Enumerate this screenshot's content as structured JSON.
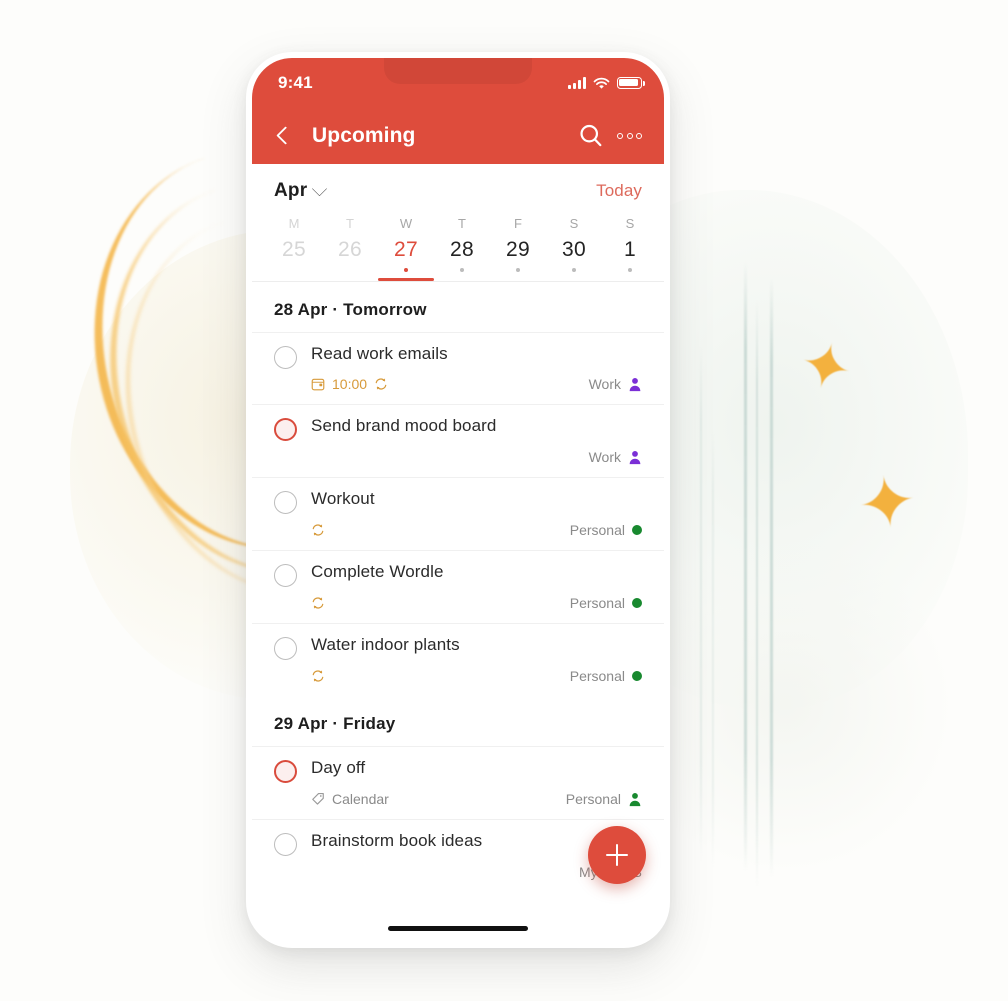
{
  "status_bar": {
    "time": "9:41",
    "icons": [
      "signal-bars-icon",
      "wifi-icon",
      "battery-icon"
    ]
  },
  "app_bar": {
    "back_icon": "chevron-left-icon",
    "title": "Upcoming",
    "search_icon": "search-icon",
    "overflow_icon": "more-options-icon"
  },
  "calendar": {
    "month_label": "Apr",
    "month_chevron_icon": "chevron-down-icon",
    "today_label": "Today",
    "days": [
      {
        "dow": "M",
        "num": "25",
        "state": "dim",
        "has_dot": false
      },
      {
        "dow": "T",
        "num": "26",
        "state": "dim",
        "has_dot": false
      },
      {
        "dow": "W",
        "num": "27",
        "state": "active",
        "has_dot": true
      },
      {
        "dow": "T",
        "num": "28",
        "state": "normal",
        "has_dot": true
      },
      {
        "dow": "F",
        "num": "29",
        "state": "normal",
        "has_dot": true
      },
      {
        "dow": "S",
        "num": "30",
        "state": "normal",
        "has_dot": true
      },
      {
        "dow": "S",
        "num": "1",
        "state": "normal",
        "has_dot": true
      }
    ]
  },
  "sections": [
    {
      "heading": "28 Apr · Tomorrow",
      "tasks": [
        {
          "title": "Read work emails",
          "checkbox": "normal",
          "due_icon": "calendar-icon",
          "due_text": "10:00",
          "repeat_icon": "repeat-icon",
          "project": "Work",
          "project_marker": "shared-person-icon",
          "project_color": "#7b2fd6"
        },
        {
          "title": "Send brand mood board",
          "checkbox": "priority",
          "due_icon": "",
          "due_text": "",
          "repeat_icon": "",
          "project": "Work",
          "project_marker": "shared-person-icon",
          "project_color": "#7b2fd6"
        },
        {
          "title": "Workout",
          "checkbox": "normal",
          "due_icon": "",
          "due_text": "",
          "repeat_icon": "repeat-icon",
          "project": "Personal",
          "project_marker": "project-dot",
          "project_color": "#18892f"
        },
        {
          "title": "Complete Wordle",
          "checkbox": "normal",
          "due_icon": "",
          "due_text": "",
          "repeat_icon": "repeat-icon",
          "project": "Personal",
          "project_marker": "project-dot",
          "project_color": "#18892f"
        },
        {
          "title": "Water indoor plants",
          "checkbox": "normal",
          "due_icon": "",
          "due_text": "",
          "repeat_icon": "repeat-icon",
          "project": "Personal",
          "project_marker": "project-dot",
          "project_color": "#18892f"
        }
      ]
    },
    {
      "heading": "29 Apr · Friday",
      "tasks": [
        {
          "title": "Day off",
          "checkbox": "priority",
          "due_icon": "label-tag-icon",
          "due_text": "Calendar",
          "repeat_icon": "",
          "project": "Personal",
          "project_marker": "shared-person-icon",
          "project_color": "#18892f"
        },
        {
          "title": "Brainstorm book ideas",
          "checkbox": "normal",
          "due_icon": "",
          "due_text": "",
          "repeat_icon": "",
          "project": "My First B",
          "project_marker": "",
          "project_color": "#8a8a8a"
        }
      ]
    }
  ],
  "fab": {
    "icon": "plus-icon",
    "label": "Add task"
  },
  "theme": {
    "accent_red": "#de4c3c",
    "amber": "#d79a3a",
    "work_purple": "#7b2fd6",
    "personal_green": "#18892f"
  }
}
